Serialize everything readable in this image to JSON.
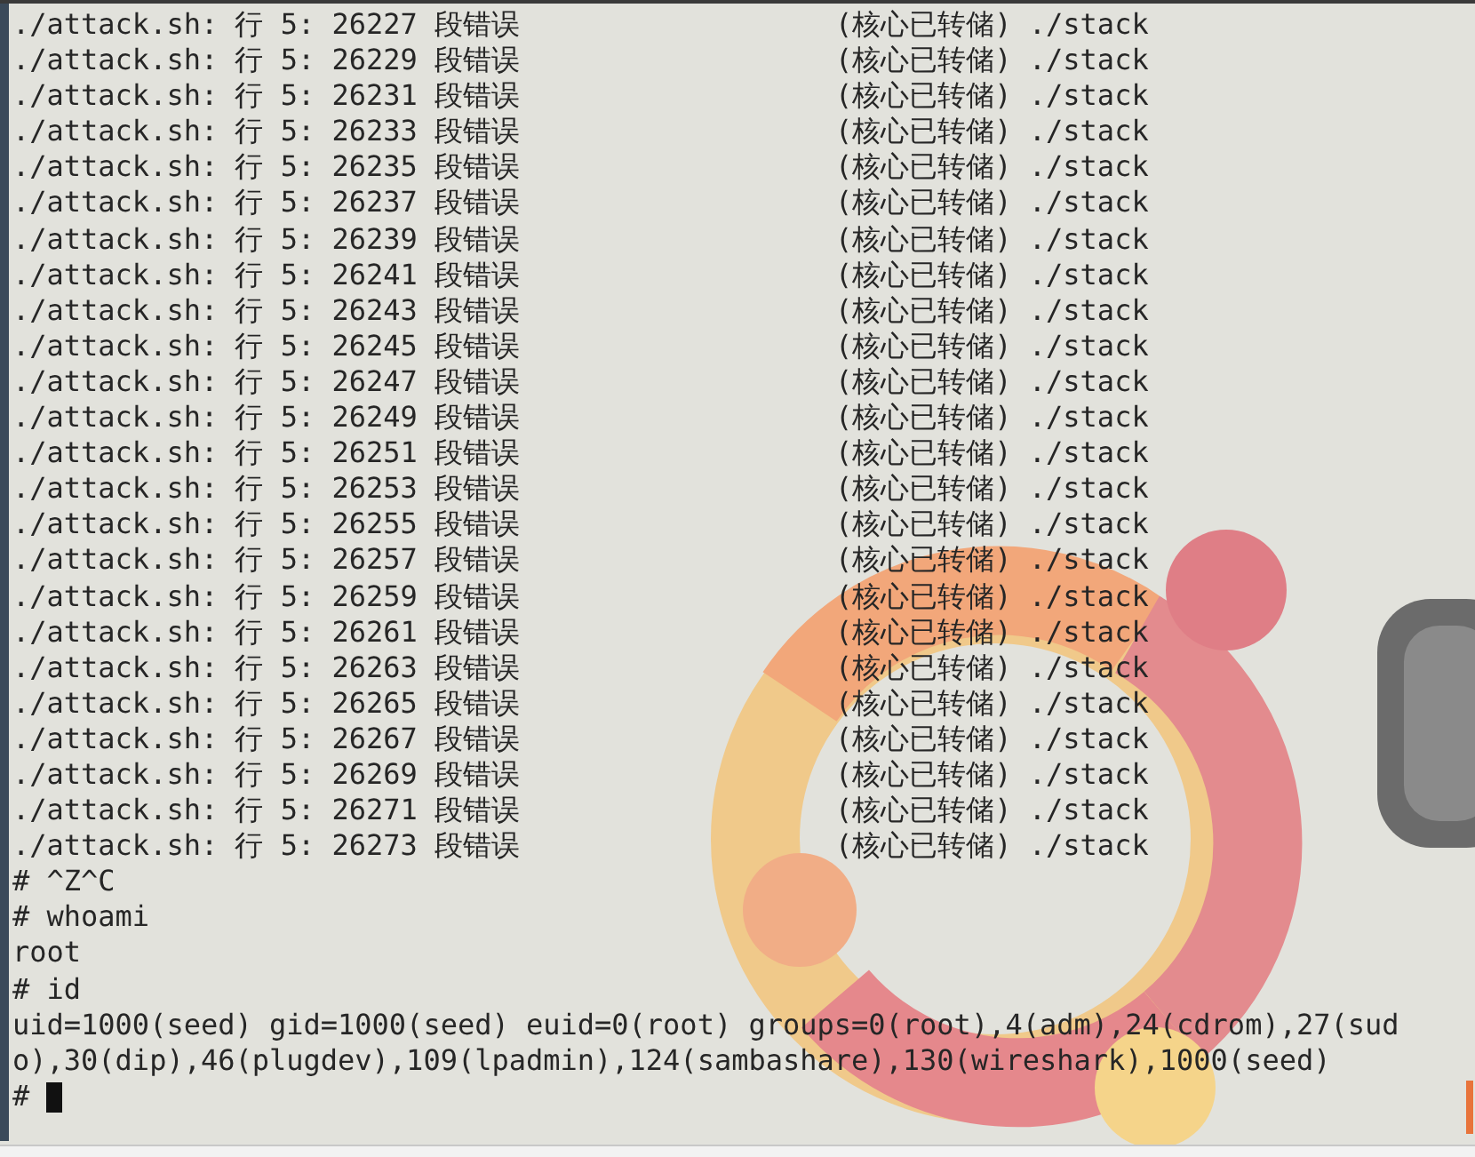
{
  "terminal": {
    "lines": [
      {
        "kind": "segfault",
        "message": "./attack.sh: 行 5: 26227 段错误",
        "detail": "(核心已转储) ./stack"
      },
      {
        "kind": "segfault",
        "message": "./attack.sh: 行 5: 26229 段错误",
        "detail": "(核心已转储) ./stack"
      },
      {
        "kind": "segfault",
        "message": "./attack.sh: 行 5: 26231 段错误",
        "detail": "(核心已转储) ./stack"
      },
      {
        "kind": "segfault",
        "message": "./attack.sh: 行 5: 26233 段错误",
        "detail": "(核心已转储) ./stack"
      },
      {
        "kind": "segfault",
        "message": "./attack.sh: 行 5: 26235 段错误",
        "detail": "(核心已转储) ./stack"
      },
      {
        "kind": "segfault",
        "message": "./attack.sh: 行 5: 26237 段错误",
        "detail": "(核心已转储) ./stack"
      },
      {
        "kind": "segfault",
        "message": "./attack.sh: 行 5: 26239 段错误",
        "detail": "(核心已转储) ./stack"
      },
      {
        "kind": "segfault",
        "message": "./attack.sh: 行 5: 26241 段错误",
        "detail": "(核心已转储) ./stack"
      },
      {
        "kind": "segfault",
        "message": "./attack.sh: 行 5: 26243 段错误",
        "detail": "(核心已转储) ./stack"
      },
      {
        "kind": "segfault",
        "message": "./attack.sh: 行 5: 26245 段错误",
        "detail": "(核心已转储) ./stack"
      },
      {
        "kind": "segfault",
        "message": "./attack.sh: 行 5: 26247 段错误",
        "detail": "(核心已转储) ./stack"
      },
      {
        "kind": "segfault",
        "message": "./attack.sh: 行 5: 26249 段错误",
        "detail": "(核心已转储) ./stack"
      },
      {
        "kind": "segfault",
        "message": "./attack.sh: 行 5: 26251 段错误",
        "detail": "(核心已转储) ./stack"
      },
      {
        "kind": "segfault",
        "message": "./attack.sh: 行 5: 26253 段错误",
        "detail": "(核心已转储) ./stack"
      },
      {
        "kind": "segfault",
        "message": "./attack.sh: 行 5: 26255 段错误",
        "detail": "(核心已转储) ./stack"
      },
      {
        "kind": "segfault",
        "message": "./attack.sh: 行 5: 26257 段错误",
        "detail": "(核心已转储) ./stack"
      },
      {
        "kind": "segfault",
        "message": "./attack.sh: 行 5: 26259 段错误",
        "detail": "(核心已转储) ./stack"
      },
      {
        "kind": "segfault",
        "message": "./attack.sh: 行 5: 26261 段错误",
        "detail": "(核心已转储) ./stack"
      },
      {
        "kind": "segfault",
        "message": "./attack.sh: 行 5: 26263 段错误",
        "detail": "(核心已转储) ./stack"
      },
      {
        "kind": "segfault",
        "message": "./attack.sh: 行 5: 26265 段错误",
        "detail": "(核心已转储) ./stack"
      },
      {
        "kind": "segfault",
        "message": "./attack.sh: 行 5: 26267 段错误",
        "detail": "(核心已转储) ./stack"
      },
      {
        "kind": "segfault",
        "message": "./attack.sh: 行 5: 26269 段错误",
        "detail": "(核心已转储) ./stack"
      },
      {
        "kind": "segfault",
        "message": "./attack.sh: 行 5: 26271 段错误",
        "detail": "(核心已转储) ./stack"
      },
      {
        "kind": "segfault",
        "message": "./attack.sh: 行 5: 26273 段错误",
        "detail": "(核心已转储) ./stack"
      },
      {
        "kind": "text",
        "text": "# ^Z^C"
      },
      {
        "kind": "text",
        "text": "# whoami"
      },
      {
        "kind": "text",
        "text": "root"
      },
      {
        "kind": "text",
        "text": "# id"
      },
      {
        "kind": "text",
        "text": "uid=1000(seed) gid=1000(seed) euid=0(root) groups=0(root),4(adm),24(cdrom),27(sud"
      },
      {
        "kind": "text",
        "text": "o),30(dip),46(plugdev),109(lpadmin),124(sambashare),130(wireshark),1000(seed)"
      },
      {
        "kind": "prompt",
        "text": "#"
      }
    ]
  }
}
